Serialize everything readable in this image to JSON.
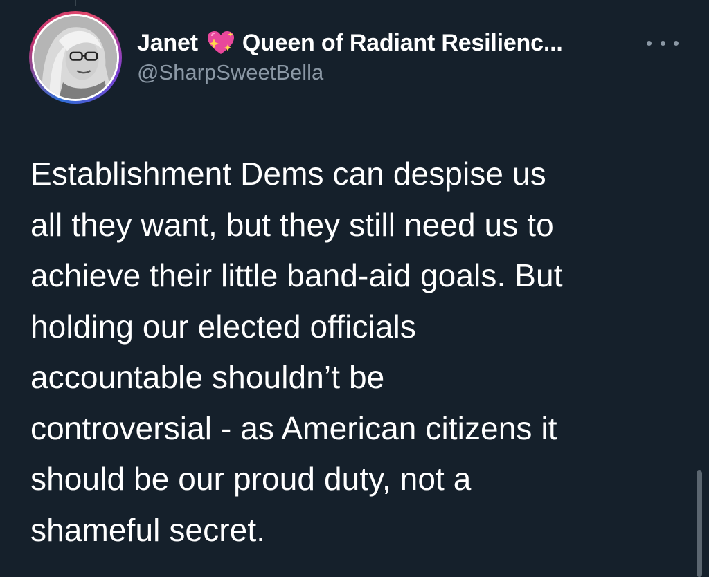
{
  "author": {
    "display_name_first": "Janet",
    "display_name_emoji_icon": "sparkling-heart-icon",
    "display_name_rest": "Queen of Radiant Resilienc...",
    "handle": "@SharpSweetBella"
  },
  "more_menu_icon": "more-horizontal-icon",
  "tweet": {
    "lines": [
      "Establishment Dems can despise us",
      "all they want, but they still need us to",
      "achieve their little band-aid goals. But",
      "holding our elected officials",
      "accountable shouldn’t be",
      "controversial - as American citizens it",
      "should be our proud duty, not a",
      "shameful secret."
    ]
  },
  "colors": {
    "background": "#15202b",
    "text_primary": "#ffffff",
    "text_secondary": "#8b98a5",
    "emoji_pink": "#e8479b"
  }
}
